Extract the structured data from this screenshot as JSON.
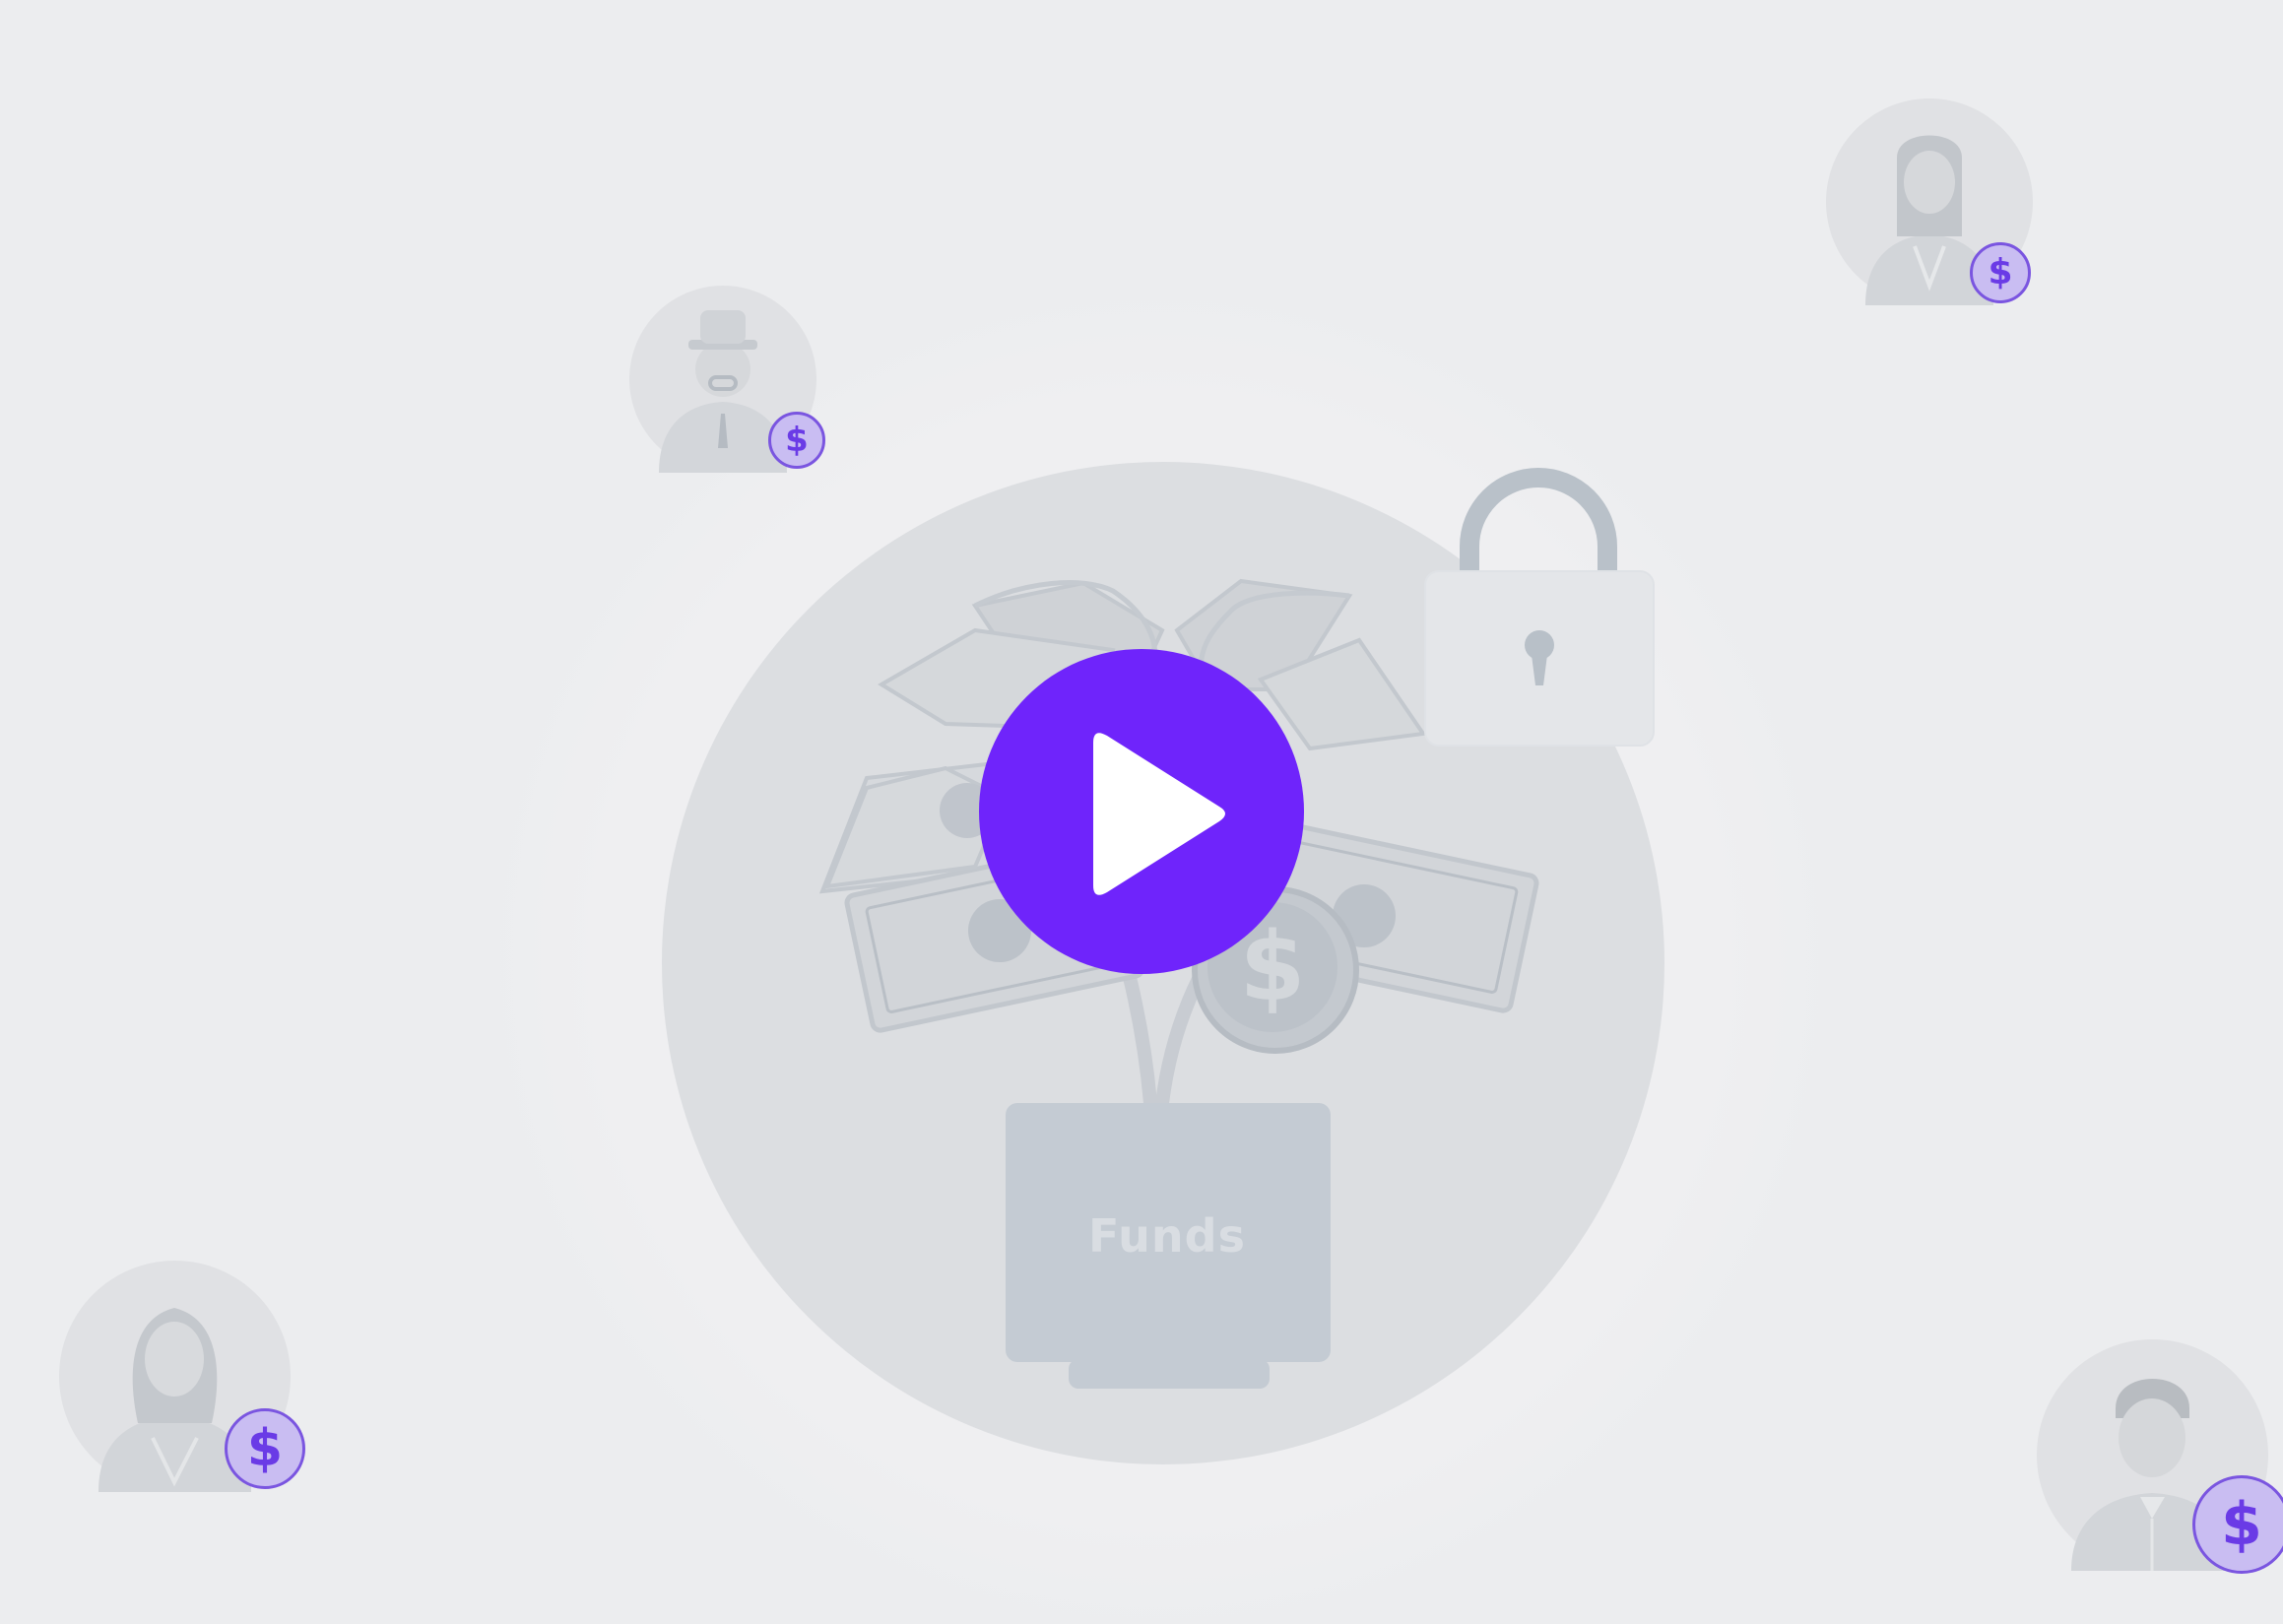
{
  "video": {
    "play_label": "",
    "accent_color": "#6f24fb"
  },
  "illustration": {
    "funds_label": "Funds",
    "icons": [
      "banknote-icon",
      "coin-icon",
      "lock-icon",
      "funds-box-icon"
    ]
  },
  "investors": [
    {
      "name": "investor-hat-man",
      "badge": "$"
    },
    {
      "name": "investor-woman-top-right",
      "badge": "$"
    },
    {
      "name": "investor-woman-bottom-left",
      "badge": "$"
    },
    {
      "name": "investor-man-bottom-right",
      "badge": "$"
    }
  ],
  "colors": {
    "background": "#ecedef",
    "circle": "#dcdee1",
    "badge_fill": "#c9bdf2",
    "badge_stroke": "#7a55e0"
  }
}
